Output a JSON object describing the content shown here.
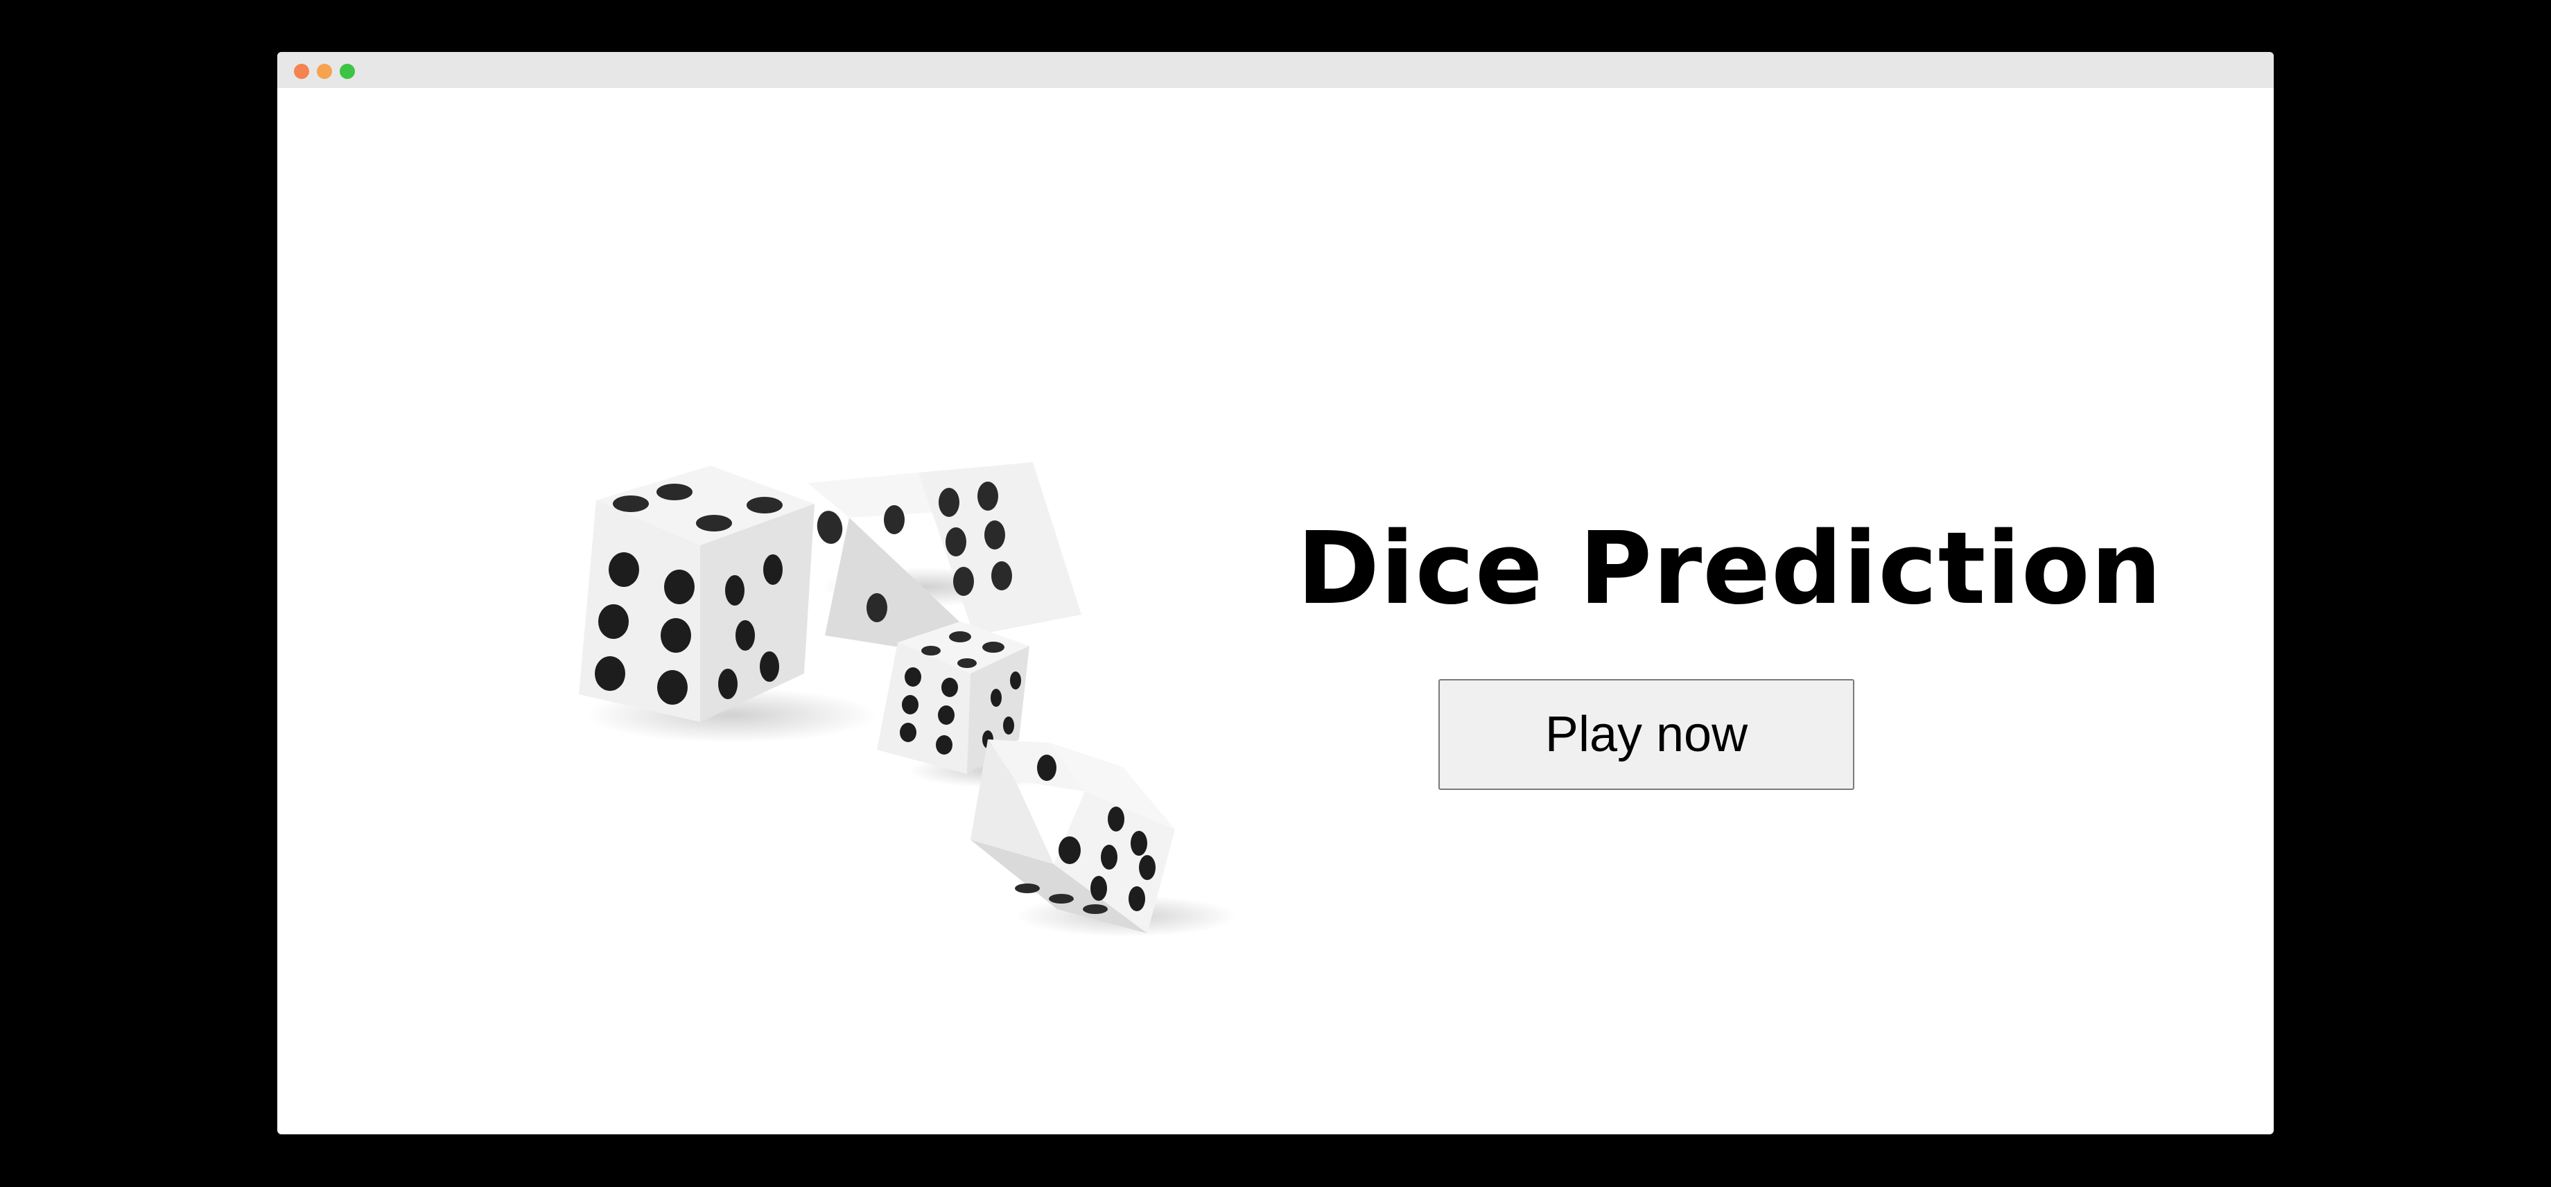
{
  "window": {
    "controls": [
      "close",
      "minimize",
      "zoom"
    ],
    "control_colors": {
      "close": "#f5834f",
      "minimize": "#f5a34f",
      "zoom": "#3cc443"
    }
  },
  "hero": {
    "title": "Dice Prediction",
    "play_button_label": "Play now",
    "button_bg": "#eff0ef",
    "image": {
      "icon": "dice-illustration-icon",
      "dice_count": 4
    }
  }
}
